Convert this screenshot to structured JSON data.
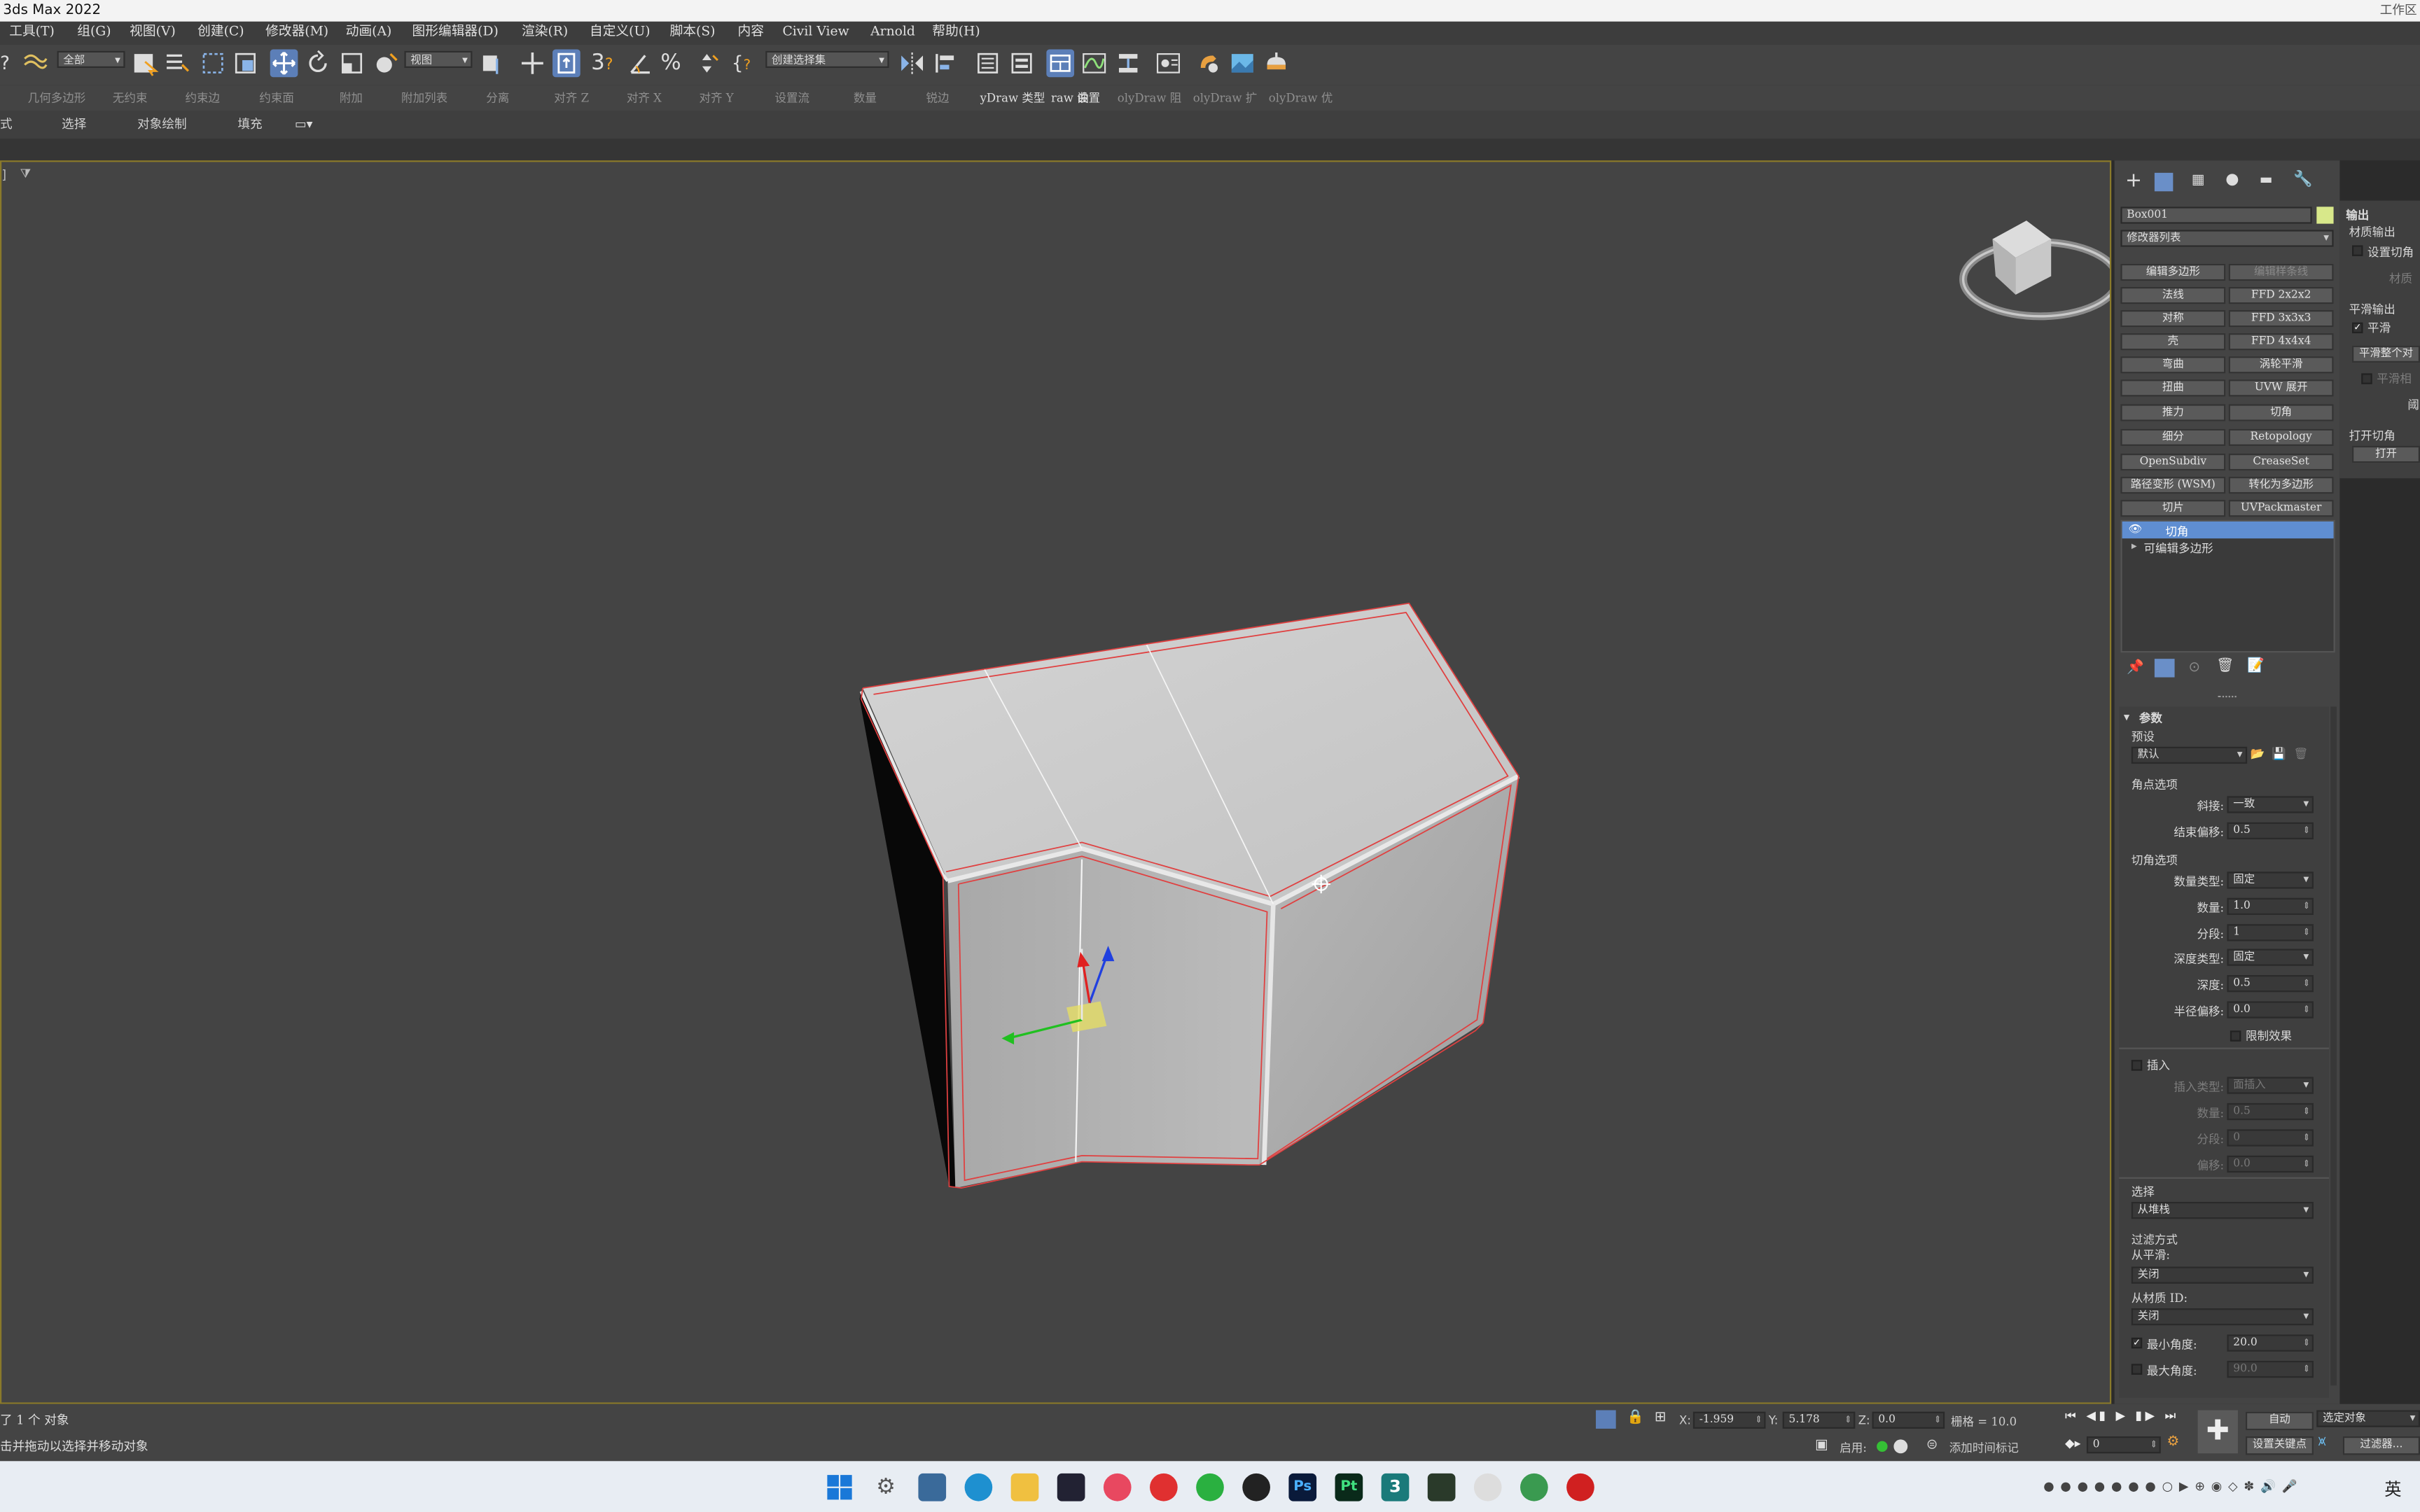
{
  "window": {
    "title": "3ds Max 2022",
    "workspace": "工作区"
  },
  "menus": [
    "工具(T)",
    "组(G)",
    "视图(V)",
    "创建(C)",
    "修改器(M)",
    "动画(A)",
    "图形编辑器(D)",
    "渲染(R)",
    "自定义(U)",
    "脚本(S)",
    "内容",
    "Civil View",
    "Arnold",
    "帮助(H)"
  ],
  "toolbar": {
    "filter": "全部",
    "refcoord": "视图",
    "selset": "创建选择集"
  },
  "ribbon": [
    "几何多边形",
    "无约束",
    "约束边",
    "约束面",
    "附加",
    "附加列表",
    "分离",
    "对齐 Z",
    "对齐 X",
    "对齐 Y",
    "设置流",
    "数量",
    "锐边",
    "yDraw 类型",
    "raw 设置",
    "曲",
    "olyDraw 阻",
    "olyDraw 扩",
    "olyDraw 优"
  ],
  "subtabs": [
    "式",
    "选择",
    "对象绘制",
    "填充"
  ],
  "viewport": {
    "label": "]"
  },
  "cmd": {
    "object_name": "Box001",
    "object_color": "#d8e88a",
    "modlist": "修改器列表",
    "buttons": [
      [
        "编辑多边形",
        "编辑样条线"
      ],
      [
        "法线",
        "FFD 2x2x2"
      ],
      [
        "对称",
        "FFD 3x3x3"
      ],
      [
        "壳",
        "FFD 4x4x4"
      ],
      [
        "弯曲",
        "涡轮平滑"
      ],
      [
        "扭曲",
        "UVW 展开"
      ],
      [
        "推力",
        "切角"
      ],
      [
        "细分",
        "Retopology"
      ],
      [
        "OpenSubdiv",
        "CreaseSet"
      ],
      [
        "路径变形 (WSM)",
        "转化为多边形"
      ],
      [
        "切片",
        "UVPackmaster"
      ]
    ],
    "stack": [
      "切角",
      "可编辑多边形"
    ]
  },
  "params": {
    "rollout": "参数",
    "preset_label": "预设",
    "preset_value": "默认",
    "corner_header": "角点选项",
    "miter_label": "斜接:",
    "miter_value": "一致",
    "endbias_label": "结束偏移:",
    "endbias_value": "0.5",
    "chamfer_header": "切角选项",
    "amtype_label": "数量类型:",
    "amtype_value": "固定",
    "amount_label": "数量:",
    "amount_value": "1.0",
    "segments_label": "分段:",
    "segments_value": "1",
    "depthtype_label": "深度类型:",
    "depthtype_value": "固定",
    "depth_label": "深度:",
    "depth_value": "0.5",
    "radbias_label": "半径偏移:",
    "radbias_value": "0.0",
    "limit_label": "限制效果",
    "inset_label": "插入",
    "insettype_label": "插入类型:",
    "insettype_value": "面插入",
    "inamount_label": "数量:",
    "inamount_value": "0.5",
    "insegs_label": "分段:",
    "insegs_value": "0",
    "inoffset_label": "偏移:",
    "inoffset_value": "0.0",
    "select_header": "选择",
    "select_value": "从堆栈",
    "filter_header": "过滤方式",
    "fromsmooth_label": "从平滑:",
    "fromsmooth_value": "关闭",
    "frommat_label": "从材质 ID:",
    "frommat_value": "关闭",
    "minangle_label": "最小角度:",
    "minangle_value": "20.0",
    "maxangle_label": "最大角度:",
    "maxangle_value": "90.0"
  },
  "output": {
    "header": "输出",
    "mat_output": "材质输出",
    "set_chamfer": "设置切角",
    "material": "材质",
    "smooth_output": "平滑输出",
    "smooth": "平滑",
    "smooth_all": "平滑整个对",
    "smooth_sub": "平滑相",
    "threshold": "阈",
    "open_chamfer": "打开切角",
    "open": "打开"
  },
  "status": {
    "selected": "了 1 个 对象",
    "prompt": "击并拖动以选择并移动对象",
    "x_label": "X:",
    "x_value": "-1.959",
    "y_label": "Y:",
    "y_value": "5.178",
    "z_label": "Z:",
    "z_value": "0.0",
    "grid": "栅格 = 10.0",
    "enable": "启用:",
    "addtime": "添加时间标记",
    "auto": "自动",
    "selobj": "选定对象",
    "setkey": "设置关键点",
    "filters": "过滤器...",
    "frame": "0"
  },
  "taskbar": {
    "lang": "英"
  }
}
